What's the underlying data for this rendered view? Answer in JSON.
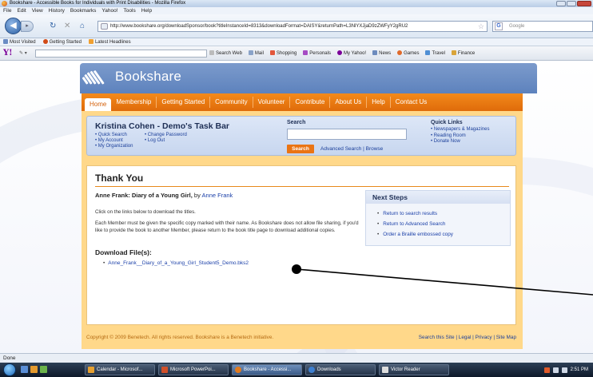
{
  "window": {
    "title": "Bookshare - Accessible Books for Individuals with Print Disabilities - Mozilla Firefox"
  },
  "menubar": [
    "File",
    "Edit",
    "View",
    "History",
    "Bookmarks",
    "Yahoo!",
    "Tools",
    "Help"
  ],
  "navbar": {
    "url": "http://www.bookshare.org/downloadSponsor/book?titleInstanceId=8313&downloadFormat=DAISY&returnPath=L3NlYXJjaD9zZWFyY2gRU2",
    "search_placeholder": "Google"
  },
  "bookmarks": [
    "Most Visited",
    "Getting Started",
    "Latest Headlines"
  ],
  "yahoo_toolbar": {
    "logo": "Y!",
    "items": [
      "Search Web",
      "Mail",
      "Shopping",
      "Personals",
      "My Yahoo!",
      "News",
      "Games",
      "Travel",
      "Finance"
    ]
  },
  "site": {
    "logo_text": "Bookshare",
    "nav": [
      "Home",
      "Membership",
      "Getting Started",
      "Community",
      "Volunteer",
      "Contribute",
      "About Us",
      "Help",
      "Contact Us"
    ],
    "taskbar": {
      "title": "Kristina Cohen - Demo's Task Bar",
      "links_col1": [
        "Quick Search",
        "My Account",
        "My Organization"
      ],
      "links_col2": [
        "Change Password",
        "Log Out"
      ],
      "search_label": "Search",
      "search_button": "Search",
      "advanced_search": "Advanced Search",
      "browse": "Browse",
      "quick_links_title": "Quick Links",
      "quick_links": [
        "Newspapers & Magazines",
        "Reading Room",
        "Donate Now"
      ]
    },
    "content": {
      "title": "Thank You",
      "book_title": "Anne Frank: Diary of a Young Girl,",
      "by": "by",
      "author": "Anne Frank",
      "para1": "Click on the links below to download the titles.",
      "para2": "Each Member must be given the specific copy marked with their name. As Bookshare does not allow file sharing, if you'd like to provide the book to another Member, please return to the book title page to download additional copies.",
      "download_heading": "Download File(s):",
      "download_file": "Anne_Frank__Diary_of_a_Young_Girl_Student5_Demo.bks2"
    },
    "next_steps": {
      "title": "Next Steps",
      "items": [
        "Return to search results",
        "Return to Advanced Search",
        "Order a Braille embossed copy"
      ]
    },
    "footer": {
      "copyright": "Copyright © 2009 Benetech. All rights reserved. Bookshare is a Benetech initiative.",
      "links": "Search this Site | Legal | Privacy | Site Map"
    }
  },
  "status": "Done",
  "taskbar_windows": {
    "tasks": [
      "Calendar - Microsof...",
      "Microsoft PowerPoi...",
      "Bookshare - Accessi...",
      "Downloads",
      "Victor Reader"
    ],
    "clock": "2:51 PM"
  },
  "colors": {
    "site_orange": "#ea7414",
    "link_blue": "#1a3fa8",
    "header_blue": "#6a8cc4"
  }
}
